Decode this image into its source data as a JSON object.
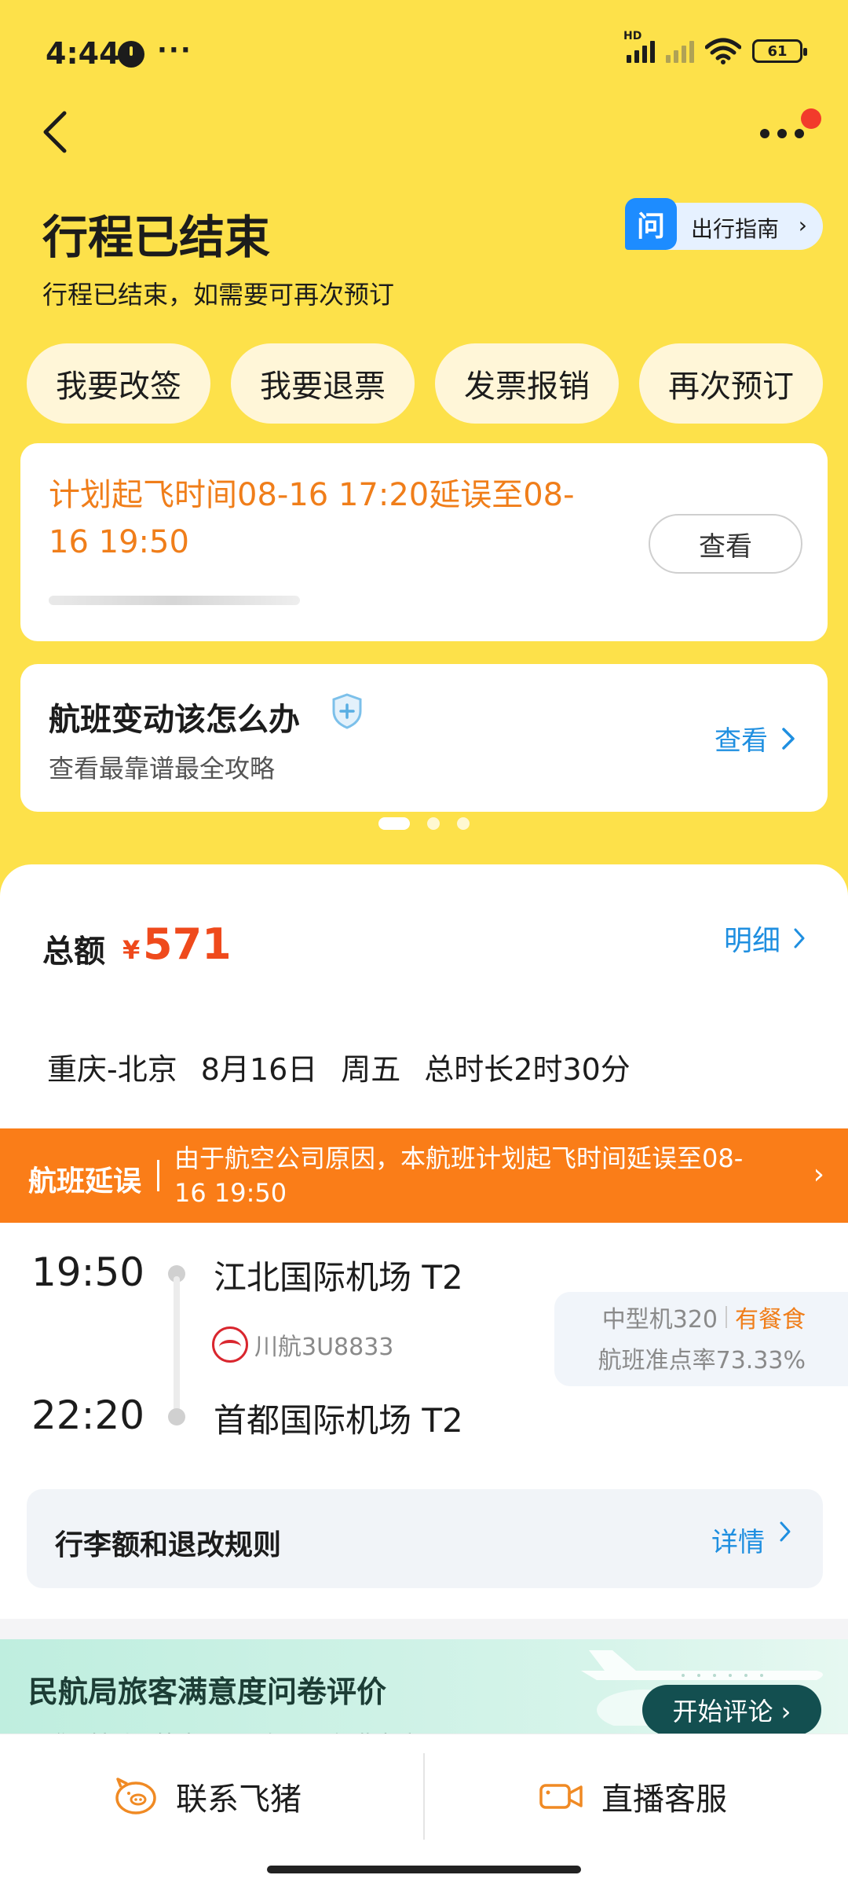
{
  "status_bar": {
    "time": "4:44",
    "overflow": "···",
    "network_label": "HD",
    "battery": "61",
    "icons": [
      "clock-icon",
      "signal-icon",
      "signal-empty-icon",
      "wifi-icon",
      "battery-icon"
    ]
  },
  "header": {
    "title": "行程已结束",
    "subtitle": "行程已结束，如需要可再次预订",
    "guide_badge": "问",
    "guide_label": "出行指南",
    "arrow": "›"
  },
  "actions": [
    {
      "label": "我要改签"
    },
    {
      "label": "我要退票"
    },
    {
      "label": "发票报销"
    },
    {
      "label": "再次预订"
    }
  ],
  "delay_card": {
    "text": "计划起飞时间08-16 17:20延误至08-16 19:50",
    "button": "查看"
  },
  "change_card": {
    "title": "航班变动该怎么办",
    "subtitle": "查看最靠谱最全攻略",
    "link": "查看"
  },
  "carousel": {
    "pages": 3,
    "active": 1
  },
  "order": {
    "total_label": "总额",
    "currency": "¥",
    "amount": "571",
    "detail_link": "明细",
    "route": "重庆-北京",
    "date": "8月16日",
    "weekday": "周五",
    "duration": "总时长2时30分"
  },
  "delay_banner": {
    "tag": "航班延误",
    "message": "由于航空公司原因，本航班计划起飞时间延误至08-16 19:50",
    "arrow": "›"
  },
  "flight": {
    "departure_time": "19:50",
    "departure_airport": "江北国际机场 T2",
    "arrival_time": "22:20",
    "arrival_airport": "首都国际机场 T2",
    "airline": "川航3U8833",
    "aircraft": "中型机320",
    "meal": "有餐食",
    "ontime_rate": "航班准点率73.33%"
  },
  "rules": {
    "label": "行李额和退改规则",
    "link": "详情"
  },
  "survey": {
    "title": "民航局旅客满意度问卷评价",
    "subtitle": "是您对机场/航空公司/购票平台满意度调研",
    "button": "开始评论 ›"
  },
  "bottom_bar": {
    "left_label": "联系飞猪",
    "right_label": "直播客服"
  },
  "colors": {
    "header_bg": "#fde14a",
    "accent_orange": "#f07e1a",
    "price_red": "#ef4a1c",
    "link_blue": "#1f8fe0",
    "banner_orange": "#fa7d18",
    "survey_button": "#134f50"
  }
}
